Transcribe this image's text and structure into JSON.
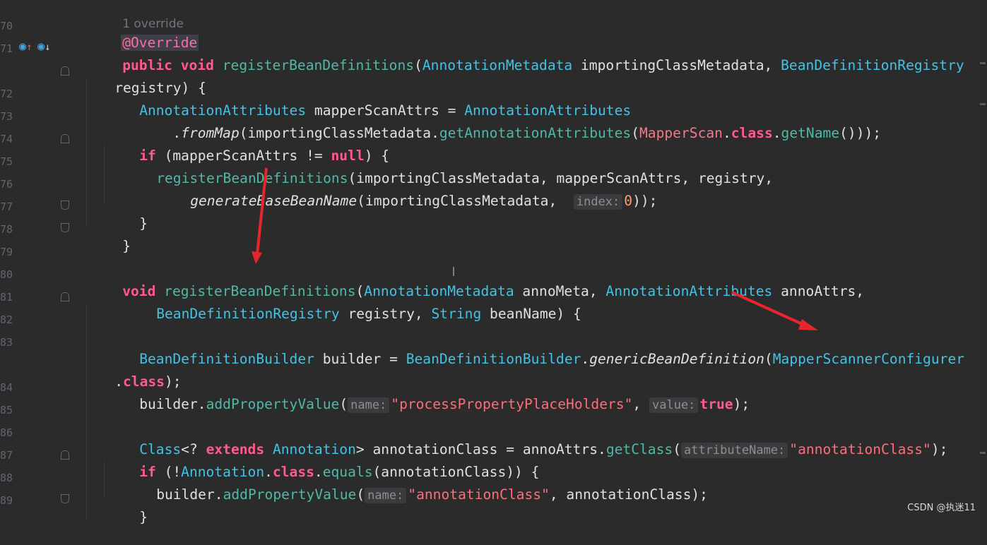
{
  "gutter": {
    "line_numbers": [
      "70",
      "71",
      "",
      "72",
      "73",
      "74",
      "75",
      "76",
      "77",
      "78",
      "79",
      "80",
      "81",
      "82",
      "83",
      "",
      "84",
      "85",
      "86",
      "87",
      "88",
      "89"
    ]
  },
  "code": {
    "usages_hint": "1 override",
    "l70_annotation": "@Override",
    "l71_public": "public",
    "l71_void": "void",
    "l71_method": "registerBeanDefinitions",
    "l71_open": "(",
    "l71_type1": "AnnotationMetadata",
    "l71_param1": " importingClassMetadata, ",
    "l71_type2": "BeanDefinitionRegistry",
    "l71b_text": "registry) {",
    "l72_type": "AnnotationAttributes",
    "l72_text": " mapperScanAttrs = ",
    "l72_type2": "AnnotationAttributes",
    "l73_dot": "    .",
    "l73_fromMap": "fromMap",
    "l73_a": "(importingClassMetadata.",
    "l73_get": "getAnnotationAttributes",
    "l73_b": "(",
    "l73_mapperscan": "MapperScan",
    "l73_c": ".",
    "l73_class": "class",
    "l73_d": ".",
    "l73_getName": "getName",
    "l73_e": "()));",
    "l74_if": "if",
    "l74_a": " (mapperScanAttrs != ",
    "l74_null": "null",
    "l74_b": ") {",
    "l75_method": "registerBeanDefinitions",
    "l75_text": "(importingClassMetadata, mapperScanAttrs, registry,",
    "l76_method": "generateBaseBeanName",
    "l76_text": "(importingClassMetadata, ",
    "l76_hint": "index:",
    "l76_num": "0",
    "l76_end": "));",
    "l77_text": "}",
    "l78_text": "}",
    "l80_void": "void",
    "l80_method": "registerBeanDefinitions",
    "l80_open": "(",
    "l80_type1": "AnnotationMetadata",
    "l80_a": " annoMeta, ",
    "l80_type2": "AnnotationAttributes",
    "l80_b": " annoAttrs,",
    "l81_type1": "BeanDefinitionRegistry",
    "l81_a": " registry, ",
    "l81_type2": "String",
    "l81_b": " beanName) {",
    "l83_type": "BeanDefinitionBuilder",
    "l83_a": " builder = ",
    "l83_type2": "BeanDefinitionBuilder",
    "l83_dot": ".",
    "l83_method": "genericBeanDefinition",
    "l83_open": "(",
    "l83_type3": "MapperScannerConfigurer",
    "l83b_dot": ".",
    "l83b_class": "class",
    "l83b_end": ");",
    "l84_a": "builder.",
    "l84_method": "addPropertyValue",
    "l84_open": "(",
    "l84_hint1": "name:",
    "l84_str": "\"processPropertyPlaceHolders\"",
    "l84_comma": ", ",
    "l84_hint2": "value:",
    "l84_true": "true",
    "l84_end": ");",
    "l86_type": "Class",
    "l86_a": "<? ",
    "l86_extends": "extends",
    "l86_space": " ",
    "l86_type2": "Annotation",
    "l86_b": "> annotationClass = annoAttrs.",
    "l86_method": "getClass",
    "l86_open": "(",
    "l86_hint": "attributeName:",
    "l86_str": "\"annotationClass\"",
    "l86_end": ");",
    "l87_if": "if",
    "l87_a": " (!",
    "l87_type": "Annotation",
    "l87_dot": ".",
    "l87_class": "class",
    "l87_dot2": ".",
    "l87_method": "equals",
    "l87_b": "(annotationClass)) {",
    "l88_a": "builder.",
    "l88_method": "addPropertyValue",
    "l88_open": "(",
    "l88_hint": "name:",
    "l88_str": "\"annotationClass\"",
    "l88_b": ", annotationClass);",
    "l89_text": "}"
  },
  "gutter_icons": {
    "override_icon": "implemented-method-icon",
    "super_icon": "overridden-method-icon"
  },
  "watermark": "CSDN @执迷11",
  "colors": {
    "background": "#2b2b2b",
    "keyword": "#ff5a8a",
    "type": "#42c3e5",
    "method": "#4fb9a7",
    "string": "#ff6d7a",
    "arrow": "#e5262d"
  }
}
